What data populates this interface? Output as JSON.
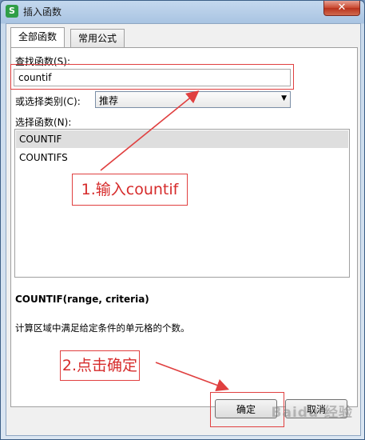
{
  "window": {
    "title": "插入函数",
    "app_icon_letter": "S",
    "close_glyph": "✕"
  },
  "tabs": [
    {
      "label": "全部函数",
      "active": true
    },
    {
      "label": "常用公式",
      "active": false
    }
  ],
  "search": {
    "label": "查找函数(S):",
    "value": "countif"
  },
  "category": {
    "label": "或选择类别(C):",
    "value": "推荐"
  },
  "function_list": {
    "label": "选择函数(N):",
    "items": [
      "COUNTIF",
      "COUNTIFS"
    ],
    "selected_index": 0
  },
  "function_info": {
    "signature": "COUNTIF(range, criteria)",
    "description": "计算区域中满足给定条件的单元格的个数。"
  },
  "buttons": {
    "ok": "确定",
    "cancel": "取消"
  },
  "annotations": {
    "step1": "1.输入countif",
    "step2": "2.点击确定",
    "color": "#e04040"
  },
  "watermark": "Baidu 经验"
}
